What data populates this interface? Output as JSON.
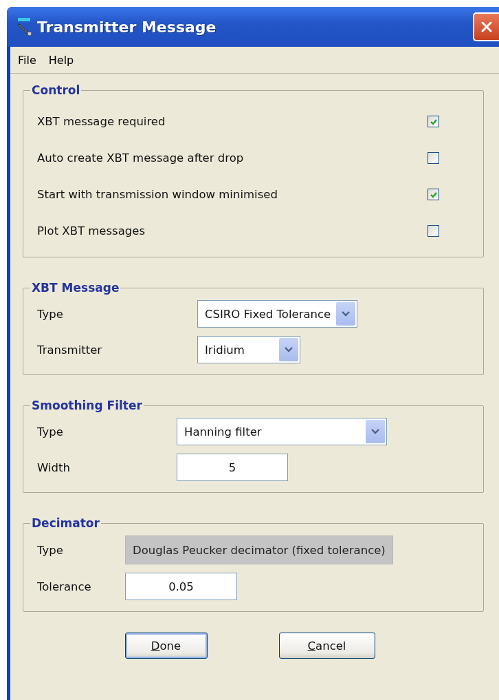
{
  "window": {
    "title": "Transmitter Message"
  },
  "menu": [
    {
      "label": "File"
    },
    {
      "label": "Help"
    }
  ],
  "sections": [
    {
      "kind": "checks",
      "title": "Control",
      "options": [
        {
          "label": "XBT message required",
          "checked": true
        },
        {
          "label": "Auto create XBT message after drop",
          "checked": false
        },
        {
          "label": "Start with transmission window minimised",
          "checked": true
        },
        {
          "label": "Plot XBT messages",
          "checked": false
        }
      ]
    },
    {
      "kind": "form",
      "title": "XBT Message",
      "fields": [
        {
          "label": "Type",
          "kind": "combo",
          "value": "CSIRO Fixed Tolerance"
        },
        {
          "label": "Transmitter",
          "kind": "combo",
          "value": "Iridium"
        }
      ]
    },
    {
      "kind": "form",
      "title": "Smoothing Filter",
      "fields": [
        {
          "label": "Type",
          "kind": "combo",
          "value": "Hanning filter"
        },
        {
          "label": "Width",
          "kind": "text",
          "value": "5"
        }
      ]
    },
    {
      "kind": "form",
      "title": "Decimator",
      "fields": [
        {
          "label": "Type",
          "kind": "readonly",
          "value": "Douglas Peucker decimator (fixed tolerance)"
        },
        {
          "label": "Tolerance",
          "kind": "text",
          "value": "0.05"
        }
      ]
    }
  ],
  "buttons": [
    {
      "label": "Done",
      "underline_first": true,
      "default": true
    },
    {
      "label": "Cancel",
      "underline_first": true,
      "default": false
    }
  ]
}
